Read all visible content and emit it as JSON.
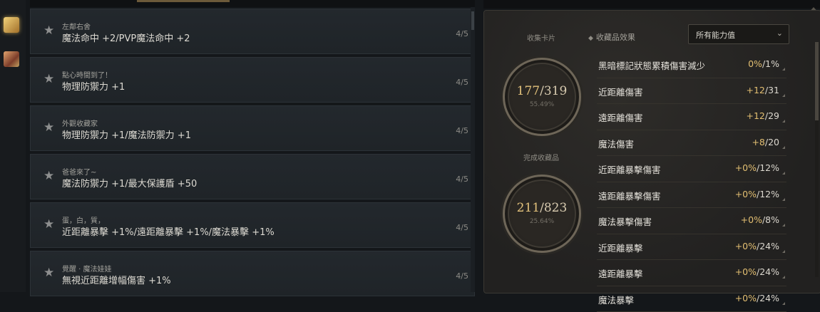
{
  "collection_list": {
    "rows": [
      {
        "subtitle": "左鄰右舍",
        "effect": "魔法命中 +2/PVP魔法命中 +2",
        "progress": "4/5"
      },
      {
        "subtitle": "點心時間到了！",
        "effect": "物理防禦力 +1",
        "progress": "4/5"
      },
      {
        "subtitle": "外觀收藏家",
        "effect": "物理防禦力 +1/魔法防禦力 +1",
        "progress": "4/5"
      },
      {
        "subtitle": "爸爸來了~",
        "effect": "魔法防禦力 +1/最大保護盾 +50",
        "progress": "4/5"
      },
      {
        "subtitle": "蛋，白，質，",
        "effect": "近距離暴擊 +1%/遠距離暴擊 +1%/魔法暴擊 +1%",
        "progress": "4/5"
      },
      {
        "subtitle": "覺醒 · 魔法娃娃",
        "effect": "無視近距離增幅傷害 +1%",
        "progress": "4/5"
      }
    ]
  },
  "summary": {
    "cards": {
      "label": "收集卡片",
      "done": "177",
      "total": "/319",
      "percent": "55.49%"
    },
    "items": {
      "label": "完成收藏品",
      "done": "211",
      "total": "/823",
      "percent": "25.64%"
    }
  },
  "effects": {
    "header": "收藏品效果",
    "filter_value": "所有能力值",
    "stats": [
      {
        "name": "黑暗標記狀態累積傷害減少",
        "bonus": "0%",
        "total": "/1%"
      },
      {
        "name": "近距離傷害",
        "bonus": "+12",
        "total": "/31"
      },
      {
        "name": "遠距離傷害",
        "bonus": "+12",
        "total": "/29"
      },
      {
        "name": "魔法傷害",
        "bonus": "+8",
        "total": "/20"
      },
      {
        "name": "近距離暴擊傷害",
        "bonus": "+0%",
        "total": "/12%"
      },
      {
        "name": "遠距離暴擊傷害",
        "bonus": "+0%",
        "total": "/12%"
      },
      {
        "name": "魔法暴擊傷害",
        "bonus": "+0%",
        "total": "/8%"
      },
      {
        "name": "近距離暴擊",
        "bonus": "+0%",
        "total": "/24%"
      },
      {
        "name": "遠距離暴擊",
        "bonus": "+0%",
        "total": "/24%"
      },
      {
        "name": "魔法暴擊",
        "bonus": "+0%",
        "total": "/24%"
      }
    ]
  },
  "colors": {
    "accent_gold": "#e3bf72",
    "panel_bg": "#2a2826",
    "list_bg": "#22272b"
  },
  "icons": [
    "star-icon",
    "book-icon",
    "chevron-down-icon",
    "diamond-icon"
  ]
}
